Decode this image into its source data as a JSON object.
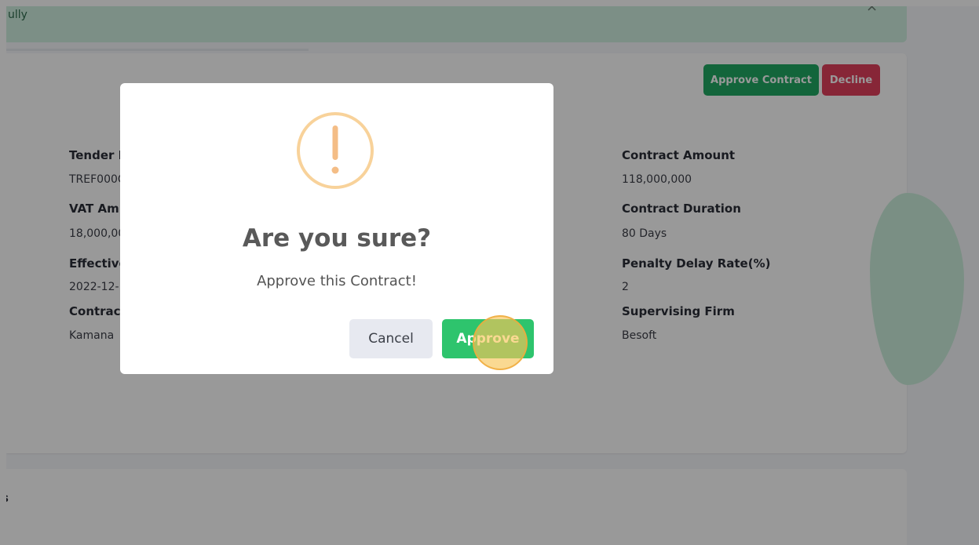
{
  "alert": {
    "message": "ully",
    "close_glyph": "×"
  },
  "header_actions": {
    "approve_contract_label": "Approve Contract",
    "decline_label": "Decline"
  },
  "details": {
    "left": [
      {
        "label": "Tender R",
        "value": "TREF000C"
      },
      {
        "label": "VAT Am",
        "value": "18,000,00"
      },
      {
        "label": "Effective",
        "value": "2022-12-"
      },
      {
        "label": "Contrac",
        "value": "Kamana"
      }
    ],
    "right": [
      {
        "label": "Contract Amount",
        "value": "118,000,000"
      },
      {
        "label": "Contract Duration",
        "value": "80 Days"
      },
      {
        "label": "Penalty Delay Rate(%)",
        "value": "2"
      },
      {
        "label": "Supervising Firm",
        "value": "Besoft"
      }
    ]
  },
  "second_card": {
    "title": "s"
  },
  "modal": {
    "icon": "warning-exclamation-icon",
    "title": "Are you sure?",
    "text": "Approve this Contract!",
    "cancel_label": "Cancel",
    "confirm_label": "Approve"
  },
  "colors": {
    "approve_green": "#21a863",
    "confirm_green": "#2ec46d",
    "decline_red": "#e2405d",
    "warning_orange": "#f8bb86",
    "alert_bg": "#cfeee0"
  }
}
